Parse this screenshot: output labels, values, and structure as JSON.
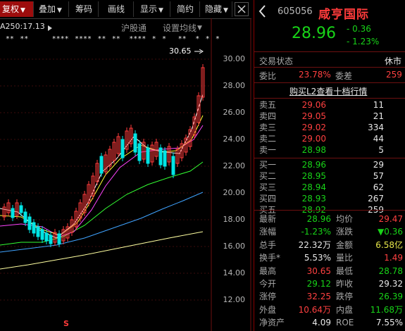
{
  "toolbar": {
    "fuquan": "复权",
    "diejia": "叠加",
    "chouma": "筹码",
    "huaxian": "画线",
    "xianshi": "显示",
    "jianyue": "简约",
    "yincang": "隐藏",
    "close_icon": "close-icon"
  },
  "chart": {
    "ma_label": "A250:17.13",
    "link_hugutong": "沪股通",
    "link_setting": "设置均线",
    "high_label": "30.65",
    "marker_s": "S",
    "stars": "  **  **        ****  ****  **  **   ****  *  *    **   *  *  *",
    "price_ticks": [
      "30.00",
      "28.00",
      "26.00",
      "24.00",
      "22.00",
      "20.00",
      "18.00",
      "16.00",
      "14.00",
      "12.00"
    ],
    "colors": {
      "up": "#ff3b3b",
      "down": "#00e5e5",
      "ma5": "#ffffff",
      "ma10": "#ffff33",
      "ma20": "#ff44ff",
      "ma60": "#33ff33",
      "ma120": "#3fa3ff",
      "ma250": "#ffffa0"
    }
  },
  "quote": {
    "code": "605056",
    "name": "咸亨国际",
    "price": "28.96",
    "change": "- 0.36",
    "change_pct": "- 1.23%"
  },
  "status": {
    "label": "交易状态",
    "value": "休市",
    "weibi_label": "委比",
    "weibi_value": "23.78%",
    "weicha_label": "委差",
    "weicha_value": "259",
    "l2_link": "购买L2查看十档行情"
  },
  "asks": [
    {
      "label": "卖五",
      "price": "29.06",
      "vol": "11"
    },
    {
      "label": "卖四",
      "price": "29.05",
      "vol": "21"
    },
    {
      "label": "卖三",
      "price": "29.02",
      "vol": "334"
    },
    {
      "label": "卖二",
      "price": "29.00",
      "vol": "44"
    },
    {
      "label": "卖一",
      "price": "28.98",
      "vol": "5"
    }
  ],
  "bids": [
    {
      "label": "买一",
      "price": "28.96",
      "vol": "29"
    },
    {
      "label": "买二",
      "price": "28.95",
      "vol": "57"
    },
    {
      "label": "买三",
      "price": "28.94",
      "vol": "62"
    },
    {
      "label": "买四",
      "price": "28.93",
      "vol": "267"
    },
    {
      "label": "买五",
      "price": "28.92",
      "vol": "259"
    }
  ],
  "stats": [
    {
      "l1": "最新",
      "v1": "28.96",
      "c1": "green",
      "l2": "均价",
      "v2": "29.47",
      "c2": "red"
    },
    {
      "l1": "涨幅",
      "v1": "-1.23%",
      "c1": "green",
      "l2": "涨跌",
      "v2": "▼0.36",
      "c2": "green"
    },
    {
      "l1": "总手",
      "v1": "22.32万",
      "c1": "white",
      "l2": "金额",
      "v2": "6.58亿",
      "c2": "yellow"
    },
    {
      "l1": "换手*",
      "v1": "5.53%",
      "c1": "white",
      "l2": "量比",
      "v2": "1.49",
      "c2": "red"
    },
    {
      "l1": "最高",
      "v1": "30.65",
      "c1": "red",
      "l2": "最低",
      "v2": "28.78",
      "c2": "green"
    },
    {
      "l1": "今开",
      "v1": "29.12",
      "c1": "green",
      "l2": "昨收",
      "v2": "29.32",
      "c2": "white"
    },
    {
      "l1": "涨停",
      "v1": "32.25",
      "c1": "red",
      "l2": "跌停",
      "v2": "26.39",
      "c2": "green"
    },
    {
      "l1": "外盘",
      "v1": "10.64万",
      "c1": "red",
      "l2": "内盘",
      "v2": "11.68万",
      "c2": "green"
    },
    {
      "l1": "净资产",
      "v1": "4.09",
      "c1": "white",
      "l2": "ROE",
      "v2": "7.55%",
      "c2": "white"
    }
  ]
}
